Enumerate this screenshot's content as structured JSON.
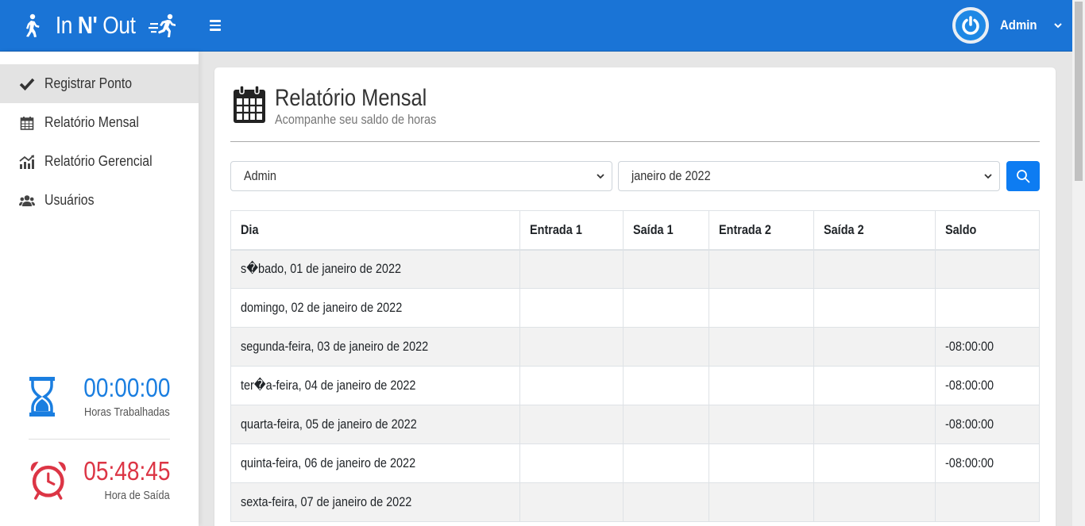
{
  "header": {
    "brand_prefix": "In",
    "brand_bold": "N'",
    "brand_suffix": "Out",
    "user_name": "Admin"
  },
  "colors": {
    "primary": "#1a74d6",
    "button": "#0d7cf2",
    "worked": "#1a7ee0",
    "exit": "#dc3545"
  },
  "sidebar": {
    "items": [
      {
        "label": "Registrar Ponto",
        "icon": "check-icon",
        "active": true
      },
      {
        "label": "Relatório Mensal",
        "icon": "calendar-icon",
        "active": false
      },
      {
        "label": "Relatório Gerencial",
        "icon": "chart-icon",
        "active": false
      },
      {
        "label": "Usuários",
        "icon": "users-icon",
        "active": false
      }
    ],
    "worked": {
      "value": "00:00:00",
      "label": "Horas Trabalhadas"
    },
    "exit": {
      "value": "05:48:45",
      "label": "Hora de Saída"
    }
  },
  "page": {
    "title": "Relatório Mensal",
    "subtitle": "Acompanhe seu saldo de horas"
  },
  "filters": {
    "user": "Admin",
    "period": "janeiro de 2022"
  },
  "table": {
    "headers": [
      "Dia",
      "Entrada 1",
      "Saída 1",
      "Entrada 2",
      "Saída 2",
      "Saldo"
    ],
    "rows": [
      [
        "s�bado, 01 de janeiro de 2022",
        "",
        "",
        "",
        "",
        ""
      ],
      [
        "domingo, 02 de janeiro de 2022",
        "",
        "",
        "",
        "",
        ""
      ],
      [
        "segunda-feira, 03 de janeiro de 2022",
        "",
        "",
        "",
        "",
        "-08:00:00"
      ],
      [
        "ter�a-feira, 04 de janeiro de 2022",
        "",
        "",
        "",
        "",
        "-08:00:00"
      ],
      [
        "quarta-feira, 05 de janeiro de 2022",
        "",
        "",
        "",
        "",
        "-08:00:00"
      ],
      [
        "quinta-feira, 06 de janeiro de 2022",
        "",
        "",
        "",
        "",
        "-08:00:00"
      ],
      [
        "sexta-feira, 07 de janeiro de 2022",
        "",
        "",
        "",
        "",
        ""
      ]
    ]
  }
}
